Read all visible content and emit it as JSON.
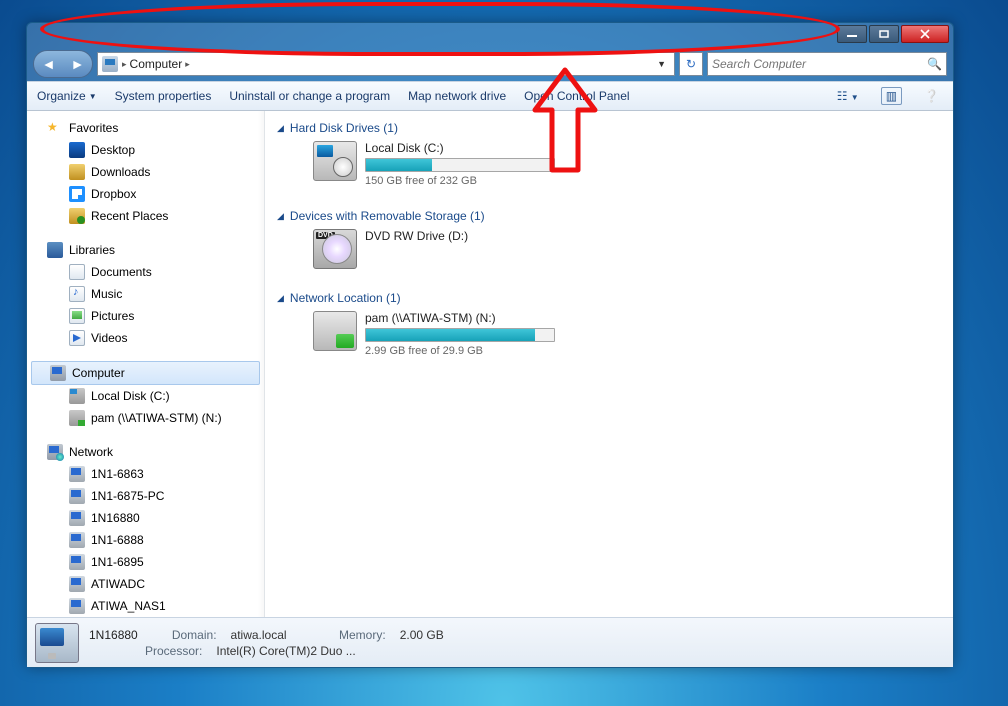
{
  "window": {
    "breadcrumb": {
      "root_icon": "computer",
      "sep": "▸",
      "items": [
        "Computer"
      ]
    },
    "search_placeholder": "Search Computer"
  },
  "toolbar": {
    "organize": "Organize",
    "system_props": "System properties",
    "uninstall": "Uninstall or change a program",
    "map_drive": "Map network drive",
    "control_panel": "Open Control Panel"
  },
  "sidebar": {
    "favorites": {
      "label": "Favorites",
      "items": [
        {
          "icon": "si-desk",
          "label": "Desktop"
        },
        {
          "icon": "si-dl",
          "label": "Downloads"
        },
        {
          "icon": "si-db",
          "label": "Dropbox"
        },
        {
          "icon": "si-rec",
          "label": "Recent Places"
        }
      ]
    },
    "libraries": {
      "label": "Libraries",
      "items": [
        {
          "icon": "si-doc",
          "label": "Documents"
        },
        {
          "icon": "si-mus",
          "label": "Music"
        },
        {
          "icon": "si-pic",
          "label": "Pictures"
        },
        {
          "icon": "si-vid",
          "label": "Videos"
        }
      ]
    },
    "computer": {
      "label": "Computer",
      "items": [
        {
          "icon": "si-hd",
          "label": "Local Disk (C:)"
        },
        {
          "icon": "si-net",
          "label": "pam (\\\\ATIWA-STM) (N:)"
        }
      ]
    },
    "network": {
      "label": "Network",
      "items": [
        {
          "icon": "si-pc",
          "label": "1N1-6863"
        },
        {
          "icon": "si-pc",
          "label": "1N1-6875-PC"
        },
        {
          "icon": "si-pc",
          "label": "1N16880"
        },
        {
          "icon": "si-pc",
          "label": "1N1-6888"
        },
        {
          "icon": "si-pc",
          "label": "1N1-6895"
        },
        {
          "icon": "si-pc",
          "label": "ATIWADC"
        },
        {
          "icon": "si-pc",
          "label": "ATIWA_NAS1"
        }
      ]
    }
  },
  "sections": {
    "hdd": {
      "title": "Hard Disk Drives (1)",
      "drive": {
        "title": "Local Disk (C:)",
        "free": "150 GB free of 232 GB",
        "fill_pct": 35
      }
    },
    "remov": {
      "title": "Devices with Removable Storage (1)",
      "drive": {
        "title": "DVD RW Drive (D:)"
      }
    },
    "net": {
      "title": "Network Location (1)",
      "drive": {
        "title": "pam (\\\\ATIWA-STM) (N:)",
        "free": "2.99 GB free of 29.9 GB",
        "fill_pct": 90
      }
    }
  },
  "details": {
    "name": "1N16880",
    "domain_label": "Domain:",
    "domain_val": "atiwa.local",
    "proc_label": "Processor:",
    "proc_val": "Intel(R) Core(TM)2 Duo ...",
    "mem_label": "Memory:",
    "mem_val": "2.00 GB"
  }
}
